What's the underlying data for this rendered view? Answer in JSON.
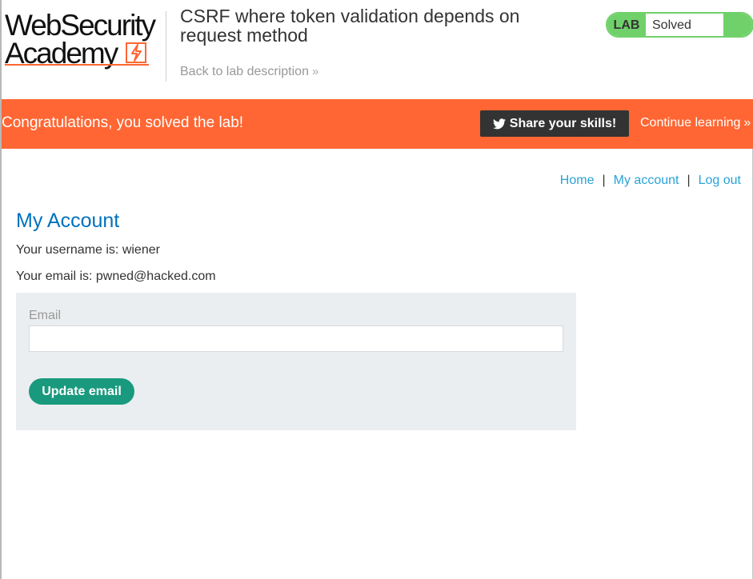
{
  "header": {
    "logo_line1": "WebSecurity",
    "logo_line2": "Academy",
    "lab_title": "CSRF where token validation depends on request method",
    "back_link": "Back to lab description",
    "status_label": "LAB",
    "status_text": "Solved"
  },
  "banner": {
    "message": "Congratulations, you solved the lab!",
    "share_label": "Share your skills!",
    "continue_label": "Continue learning",
    "color": "#ff6633"
  },
  "nav": {
    "home": "Home",
    "my_account": "My account",
    "logout": "Log out",
    "separator": "|"
  },
  "account": {
    "heading": "My Account",
    "username_line": "Your username is: wiener",
    "email_line": "Your email is: pwned@hacked.com"
  },
  "form": {
    "email_label": "Email",
    "email_value": "",
    "submit_label": "Update email"
  },
  "colors": {
    "accent_orange": "#ff6633",
    "solved_green": "#70d16a",
    "link_blue": "#29a3d8",
    "heading_blue": "#0071bc",
    "button_teal": "#199a7e"
  }
}
